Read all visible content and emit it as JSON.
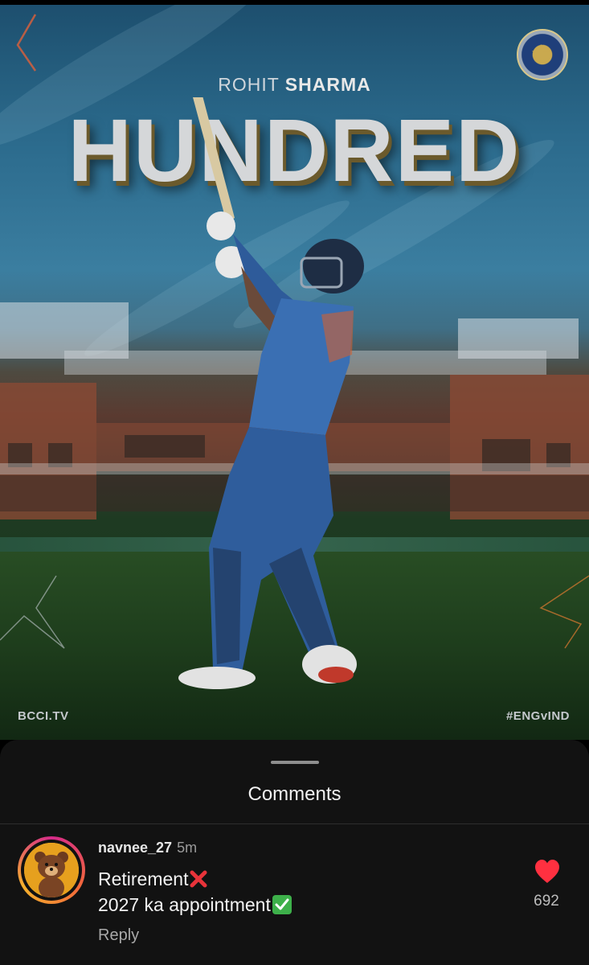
{
  "post": {
    "headline_first": "ROHIT ",
    "headline_last": "SHARMA",
    "headline_main": "HUNDRED",
    "watermark_left": "BCCI.TV",
    "watermark_right": "#ENGvIND"
  },
  "comments_sheet": {
    "title": "Comments",
    "comment": {
      "username": "navnee_27",
      "timestamp": "5m",
      "line1": "Retirement",
      "line2": "2027 ka appointment",
      "reply_label": "Reply",
      "like_count": "692"
    }
  },
  "colors": {
    "sheet_bg": "#121212",
    "like_red": "#ff3040",
    "avatar_ring": "#d62a8a"
  },
  "icons": {
    "back": "chevron-left-icon",
    "logo": "bcci-logo",
    "like": "heart-icon",
    "cross_emoji": "cross-mark-emoji",
    "check_emoji": "check-mark-emoji"
  }
}
